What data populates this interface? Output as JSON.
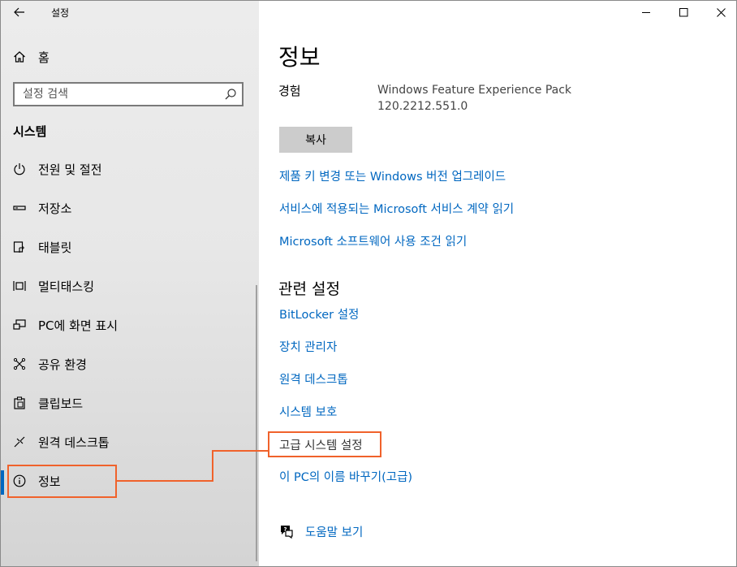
{
  "app": {
    "title": "설정"
  },
  "sidebar": {
    "home_label": "홈",
    "search_placeholder": "설정 검색",
    "section_title": "시스템",
    "items": [
      {
        "label": "전원 및 절전",
        "icon": "power-icon"
      },
      {
        "label": "저장소",
        "icon": "storage-icon"
      },
      {
        "label": "태블릿",
        "icon": "tablet-icon"
      },
      {
        "label": "멀티태스킹",
        "icon": "multitasking-icon"
      },
      {
        "label": "PC에 화면 표시",
        "icon": "projecting-icon"
      },
      {
        "label": "공유 환경",
        "icon": "shared-experiences-icon"
      },
      {
        "label": "클립보드",
        "icon": "clipboard-icon"
      },
      {
        "label": "원격 데스크톱",
        "icon": "remote-desktop-icon"
      },
      {
        "label": "정보",
        "icon": "info-icon",
        "selected": true
      }
    ]
  },
  "main": {
    "title": "정보",
    "experience_label": "경험",
    "experience_value_line1": "Windows Feature Experience Pack",
    "experience_value_line2": "120.2212.551.0",
    "copy_label": "복사",
    "links": [
      "제품 키 변경 또는 Windows 버전 업그레이드",
      "서비스에 적용되는 Microsoft 서비스 계약 읽기",
      "Microsoft 소프트웨어 사용 조건 읽기"
    ],
    "related_title": "관련 설정",
    "related_links": [
      "BitLocker 설정",
      "장치 관리자",
      "원격 데스크톱",
      "시스템 보호",
      "고급 시스템 설정",
      "이 PC의 이름 바꾸기(고급)"
    ],
    "help_label": "도움말 보기"
  },
  "colors": {
    "accent": "#0067c0",
    "annotation": "#f0622b"
  }
}
